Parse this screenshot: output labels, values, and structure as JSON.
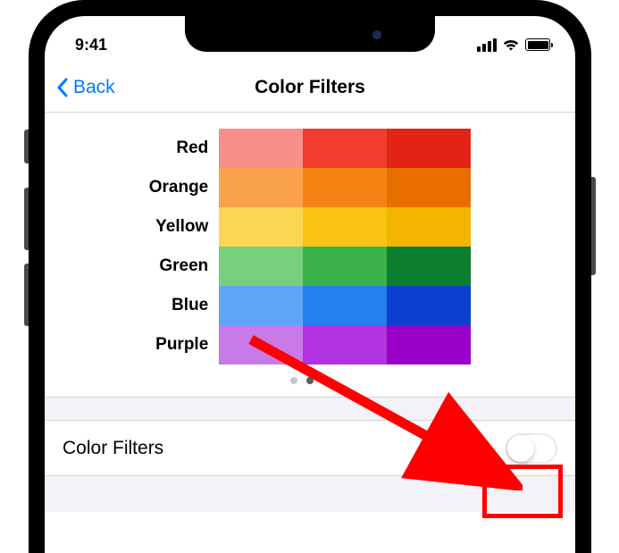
{
  "status": {
    "time": "9:41"
  },
  "nav": {
    "back_label": "Back",
    "title": "Color Filters"
  },
  "preview": {
    "rows": [
      {
        "label": "Red",
        "cols": [
          "#f98f8b",
          "#f03d2e",
          "#e32316"
        ]
      },
      {
        "label": "Orange",
        "cols": [
          "#f9a24b",
          "#f58314",
          "#e86e00"
        ]
      },
      {
        "label": "Yellow",
        "cols": [
          "#fbd653",
          "#f9c313",
          "#f5b400"
        ]
      },
      {
        "label": "Green",
        "cols": [
          "#78cf7e",
          "#3bb24a",
          "#0a7d2e"
        ]
      },
      {
        "label": "Blue",
        "cols": [
          "#5da6f7",
          "#2680f0",
          "#0b3fcf"
        ]
      },
      {
        "label": "Purple",
        "cols": [
          "#c77ae8",
          "#b133e0",
          "#9800c8"
        ]
      }
    ],
    "page_count": 3,
    "active_page": 1
  },
  "settings": {
    "color_filters_label": "Color Filters",
    "color_filters_on": false
  }
}
